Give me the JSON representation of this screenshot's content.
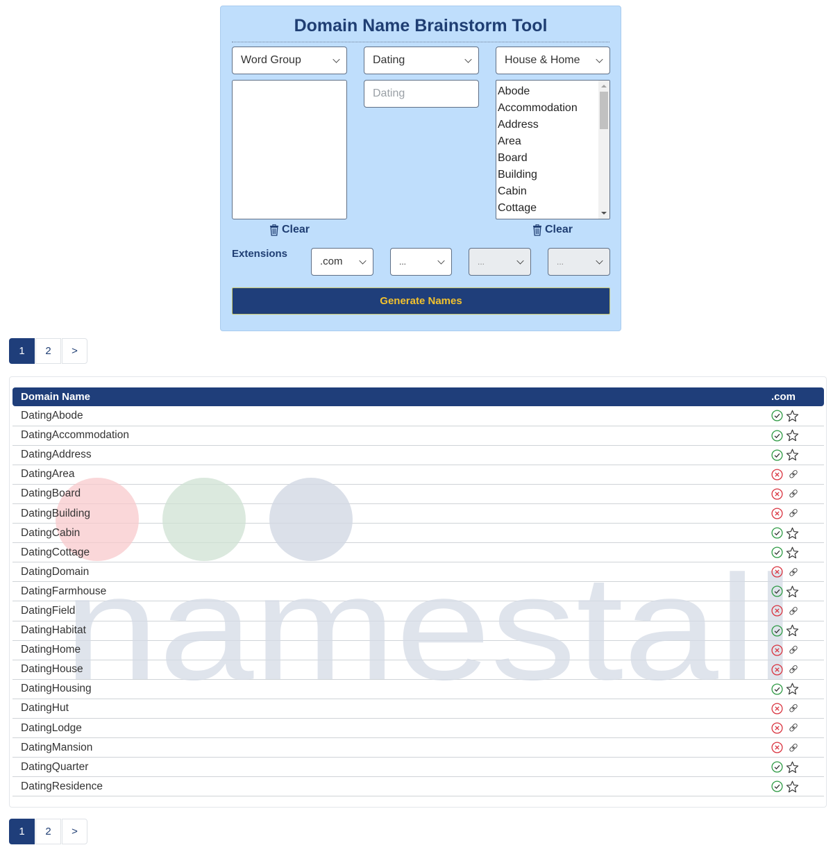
{
  "tool": {
    "title": "Domain Name Brainstorm Tool",
    "col1_select": "Word Group",
    "col2_select": "Dating",
    "col2_input_placeholder": "Dating",
    "col3_select": "House & Home",
    "col3_list": [
      "Abode",
      "Accommodation",
      "Address",
      "Area",
      "Board",
      "Building",
      "Cabin",
      "Cottage"
    ],
    "clear_label": "Clear",
    "extensions_label": "Extensions",
    "extensions": [
      ".com",
      "...",
      "...",
      "..."
    ],
    "generate_label": "Generate Names"
  },
  "pagination": {
    "pages": [
      "1",
      "2"
    ],
    "next": ">",
    "active": "1"
  },
  "results": {
    "headers": [
      "Domain Name",
      ".com"
    ],
    "rows": [
      {
        "name": "DatingAbode",
        "available": true
      },
      {
        "name": "DatingAccommodation",
        "available": true
      },
      {
        "name": "DatingAddress",
        "available": true
      },
      {
        "name": "DatingArea",
        "available": false
      },
      {
        "name": "DatingBoard",
        "available": false
      },
      {
        "name": "DatingBuilding",
        "available": false
      },
      {
        "name": "DatingCabin",
        "available": true
      },
      {
        "name": "DatingCottage",
        "available": true
      },
      {
        "name": "DatingDomain",
        "available": false
      },
      {
        "name": "DatingFarmhouse",
        "available": true
      },
      {
        "name": "DatingField",
        "available": false
      },
      {
        "name": "DatingHabitat",
        "available": true
      },
      {
        "name": "DatingHome",
        "available": false
      },
      {
        "name": "DatingHouse",
        "available": false
      },
      {
        "name": "DatingHousing",
        "available": true
      },
      {
        "name": "DatingHut",
        "available": false
      },
      {
        "name": "DatingLodge",
        "available": false
      },
      {
        "name": "DatingMansion",
        "available": false
      },
      {
        "name": "DatingQuarter",
        "available": true
      },
      {
        "name": "DatingResidence",
        "available": true
      }
    ]
  },
  "watermark": {
    "text": "namestall",
    "colors": {
      "red": "#f8c9cc",
      "green": "#cfe2d3",
      "blue": "#d2d8e4",
      "text": "#d5dbe6"
    }
  },
  "colors": {
    "brand": "#1f3e7a",
    "accent": "#f2c12e",
    "panel": "#bfdefc",
    "available": "#2e9a44",
    "taken": "#d9333f"
  }
}
